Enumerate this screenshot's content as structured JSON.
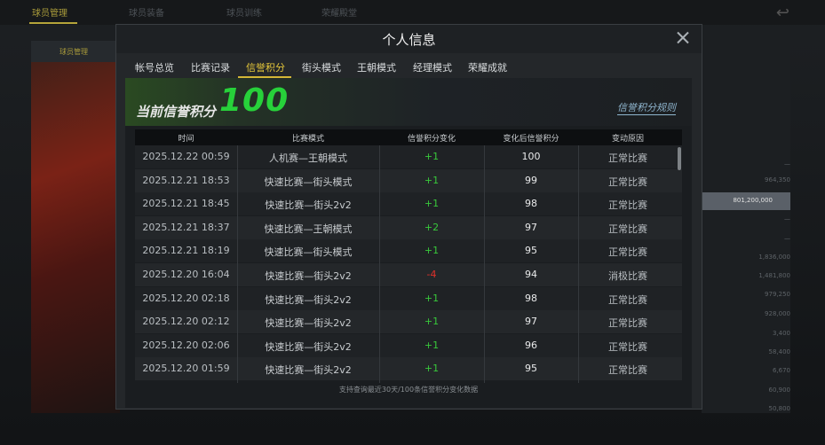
{
  "background": {
    "tabs": [
      "球员管理",
      "球员装备",
      "球员训练",
      "荣耀殿堂"
    ],
    "active_tab": 0,
    "left_tab": "球员管理",
    "right_values": [
      "—",
      "964,350",
      "—",
      "—",
      "1,836,000",
      "1,481,800",
      "979,250",
      "928,000",
      "3,400",
      "58,400",
      "6,670",
      "60,900",
      "50,800"
    ],
    "highlight_value": "801,200,000"
  },
  "modal": {
    "title": "个人信息",
    "tabs": [
      "帐号总览",
      "比赛记录",
      "信誉积分",
      "街头模式",
      "王朝模式",
      "经理模式",
      "荣耀成就"
    ],
    "active_tab": 2,
    "banner": {
      "label": "当前信誉积分",
      "value": "100",
      "rules_link": "信誉积分规则"
    },
    "table": {
      "headers": [
        "时间",
        "比赛模式",
        "信誉积分变化",
        "变化后信誉积分",
        "变动原因"
      ],
      "rows": [
        {
          "time": "2025.12.22  00:59",
          "mode": "人机赛—王朝模式",
          "change": "+1",
          "after": "100",
          "reason": "正常比赛"
        },
        {
          "time": "2025.12.21  18:53",
          "mode": "快速比赛—街头模式",
          "change": "+1",
          "after": "99",
          "reason": "正常比赛"
        },
        {
          "time": "2025.12.21  18:45",
          "mode": "快速比赛—街头2v2",
          "change": "+1",
          "after": "98",
          "reason": "正常比赛"
        },
        {
          "time": "2025.12.21  18:37",
          "mode": "快速比赛—王朝模式",
          "change": "+2",
          "after": "97",
          "reason": "正常比赛"
        },
        {
          "time": "2025.12.21  18:19",
          "mode": "快速比赛—街头模式",
          "change": "+1",
          "after": "95",
          "reason": "正常比赛"
        },
        {
          "time": "2025.12.20  16:04",
          "mode": "快速比赛—街头2v2",
          "change": "-4",
          "after": "94",
          "reason": "消极比赛"
        },
        {
          "time": "2025.12.20  02:18",
          "mode": "快速比赛—街头2v2",
          "change": "+1",
          "after": "98",
          "reason": "正常比赛"
        },
        {
          "time": "2025.12.20  02:12",
          "mode": "快速比赛—街头2v2",
          "change": "+1",
          "after": "97",
          "reason": "正常比赛"
        },
        {
          "time": "2025.12.20  02:06",
          "mode": "快速比赛—街头2v2",
          "change": "+1",
          "after": "96",
          "reason": "正常比赛"
        },
        {
          "time": "2025.12.20  01:59",
          "mode": "快速比赛—街头2v2",
          "change": "+1",
          "after": "95",
          "reason": "正常比赛"
        }
      ]
    },
    "footer_note": "支持查询最近30天/100条信誉积分变化数据"
  },
  "colors": {
    "accent": "#e4c63a",
    "positive": "#38c93b",
    "negative": "#e0302a",
    "score": "#27d13a"
  }
}
